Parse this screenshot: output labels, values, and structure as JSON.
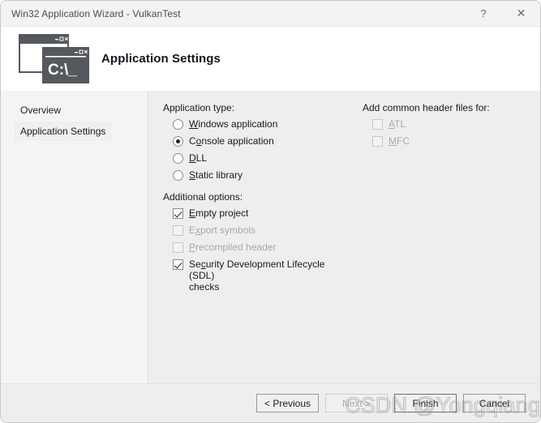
{
  "window": {
    "title": "Win32 Application Wizard - VulkanTest",
    "help_label": "?",
    "close_label": "✕"
  },
  "header": {
    "title": "Application Settings",
    "icon_name": "console-windows-icon",
    "icon_text": "C:\\_",
    "icon_buttons": "_ ▫ ✕"
  },
  "sidebar": {
    "items": [
      {
        "label": "Overview",
        "selected": false
      },
      {
        "label": "Application Settings",
        "selected": true
      }
    ]
  },
  "main": {
    "application_type": {
      "label": "Application type:",
      "options": [
        {
          "pre": "W",
          "accel": "",
          "post": "indows application",
          "checked": false,
          "disabled": false,
          "a_pre": "",
          "a_key": "W",
          "a_post": "indows application"
        },
        {
          "checked": true,
          "disabled": false,
          "a_pre": "C",
          "a_key": "o",
          "a_post": "nsole application"
        },
        {
          "checked": false,
          "disabled": false,
          "a_pre": "",
          "a_key": "D",
          "a_post": "LL"
        },
        {
          "checked": false,
          "disabled": false,
          "a_pre": "",
          "a_key": "S",
          "a_post": "tatic library"
        }
      ]
    },
    "additional_options": {
      "label": "Additional options:",
      "options": [
        {
          "checked": true,
          "disabled": false,
          "a_pre": "",
          "a_key": "E",
          "a_post": "mpty project"
        },
        {
          "checked": false,
          "disabled": true,
          "a_pre": "E",
          "a_key": "x",
          "a_post": "port symbols"
        },
        {
          "checked": false,
          "disabled": true,
          "a_pre": "",
          "a_key": "P",
          "a_post": "recompiled header"
        },
        {
          "checked": true,
          "disabled": false,
          "a_pre": "Se",
          "a_key": "c",
          "a_post": "urity Development Lifecycle (SDL)\nchecks"
        }
      ]
    },
    "header_files": {
      "label": "Add common header files for:",
      "options": [
        {
          "checked": false,
          "disabled": true,
          "a_pre": "",
          "a_key": "A",
          "a_post": "TL"
        },
        {
          "checked": false,
          "disabled": true,
          "a_pre": "",
          "a_key": "M",
          "a_post": "FC"
        }
      ]
    }
  },
  "footer": {
    "buttons": [
      {
        "label": "< Previous",
        "disabled": false,
        "default": false
      },
      {
        "label": "Next >",
        "disabled": true,
        "default": false
      },
      {
        "label": "Finish",
        "disabled": false,
        "default": true
      },
      {
        "label": "Cancel",
        "disabled": false,
        "default": false
      }
    ]
  },
  "watermark": {
    "text": "CSDN @Yongqiang_Cheng"
  },
  "colors": {
    "titlebar": "#f3f3f3",
    "sidebar": "#f4f4f4",
    "content": "#eeeeee",
    "icon": "#55585c",
    "disabled_text": "#a9a9a9"
  }
}
